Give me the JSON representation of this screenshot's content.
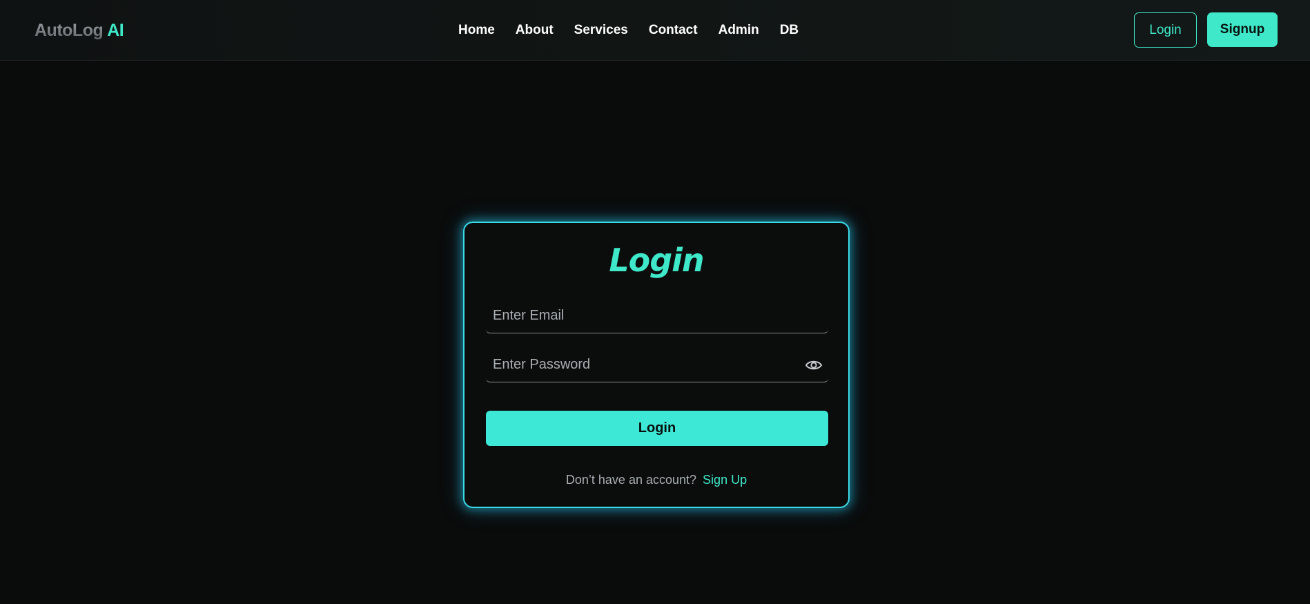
{
  "navbar": {
    "brand_main": "AutoLog",
    "brand_accent": "AI",
    "links": [
      "Home",
      "About",
      "Services",
      "Contact",
      "Admin",
      "DB"
    ],
    "login_label": "Login",
    "signup_label": "Signup"
  },
  "login_form": {
    "title": "Login",
    "email_placeholder": "Enter Email",
    "password_placeholder": "Enter Password",
    "submit_label": "Login",
    "no_account_text": "Don’t have an account?",
    "signup_link": "Sign Up",
    "password_toggle_icon": "eye-icon"
  },
  "colors": {
    "accent": "#3ee8c8",
    "glow_border": "#3ad9e6",
    "background": "#0a0b0b"
  }
}
